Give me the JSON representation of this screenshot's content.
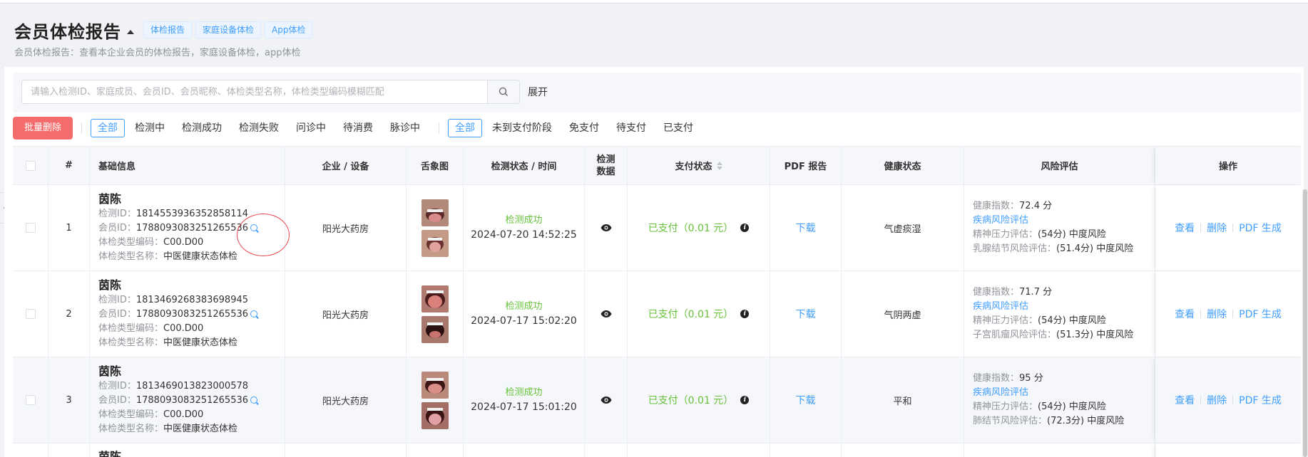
{
  "header": {
    "title": "会员体检报告",
    "tags": [
      "体检报告",
      "家庭设备体检",
      "App体检"
    ],
    "description": "会员体检报告：查看本企业会员的体检报告，家庭设备体检，app体检"
  },
  "search": {
    "placeholder": "请输入检测ID、家庭成员、会员ID、会员昵称、体检类型名称，体检类型编码模糊匹配",
    "expand_label": "展开"
  },
  "toolbar": {
    "batch_delete_label": "批量删除",
    "status_filters": [
      "全部",
      "检测中",
      "检测成功",
      "检测失败",
      "问诊中",
      "待消费",
      "脉诊中"
    ],
    "status_active": 0,
    "pay_filters": [
      "全部",
      "未到支付阶段",
      "免支付",
      "待支付",
      "已支付"
    ],
    "pay_active": 0
  },
  "table": {
    "headers": [
      "#",
      "基础信息",
      "企业 / 设备",
      "舌象图",
      "检测状态 / 时间",
      "检测数据",
      "支付状态",
      "PDF 报告",
      "健康状态",
      "风险评估",
      "操作"
    ],
    "labels": {
      "detect_id": "检测ID：",
      "member_id": "会员ID：",
      "type_code": "体检类型编码：",
      "type_name": "体检类型名称：",
      "health_index": "健康指数：",
      "download": "下载",
      "view": "查看",
      "delete": "删除",
      "pdf_generate": "PDF 生成"
    },
    "rows": [
      {
        "index": "1",
        "name": "茵陈",
        "detect_id": "1814553936352858114",
        "member_id": "1788093083251265536",
        "type_code": "C00.D00",
        "type_name": "中医健康状态体检",
        "org": "阳光大药房",
        "status": "检测成功",
        "time": "2024-07-20 14:52:25",
        "pay": "已支付（0.01 元）",
        "health": "气虚痰湿",
        "health_index": "72.4 分",
        "risk_link": "疾病风险评估",
        "risk1_label": "精神压力评估：",
        "risk1_value": "(54分) 中度风险",
        "risk2_label": "乳腺结节风险评估：",
        "risk2_value": "(51.4分) 中度风险"
      },
      {
        "index": "2",
        "name": "茵陈",
        "detect_id": "1813469268383698945",
        "member_id": "1788093083251265536",
        "type_code": "C00.D00",
        "type_name": "中医健康状态体检",
        "org": "阳光大药房",
        "status": "检测成功",
        "time": "2024-07-17 15:02:20",
        "pay": "已支付（0.01 元）",
        "health": "气阴两虚",
        "health_index": "71.7 分",
        "risk_link": "疾病风险评估",
        "risk1_label": "精神压力评估：",
        "risk1_value": "(54分) 中度风险",
        "risk2_label": "子宫肌瘤风险评估：",
        "risk2_value": "(51.3分) 中度风险"
      },
      {
        "index": "3",
        "name": "茵陈",
        "detect_id": "1813469013823000578",
        "member_id": "1788093083251265536",
        "type_code": "C00.D00",
        "type_name": "中医健康状态体检",
        "org": "阳光大药房",
        "status": "检测成功",
        "time": "2024-07-17 15:01:20",
        "pay": "已支付（0.01 元）",
        "health": "平和",
        "health_index": "95 分",
        "risk_link": "疾病风险评估",
        "risk1_label": "精神压力评估：",
        "risk1_value": "(54分) 中度风险",
        "risk2_label": "肺结节风险评估：",
        "risk2_value": "(72.3分) 中度风险"
      },
      {
        "name": "茵陈"
      }
    ]
  },
  "colors": {
    "primary": "#409eff",
    "danger": "#f56c6c",
    "success": "#67c23a"
  }
}
